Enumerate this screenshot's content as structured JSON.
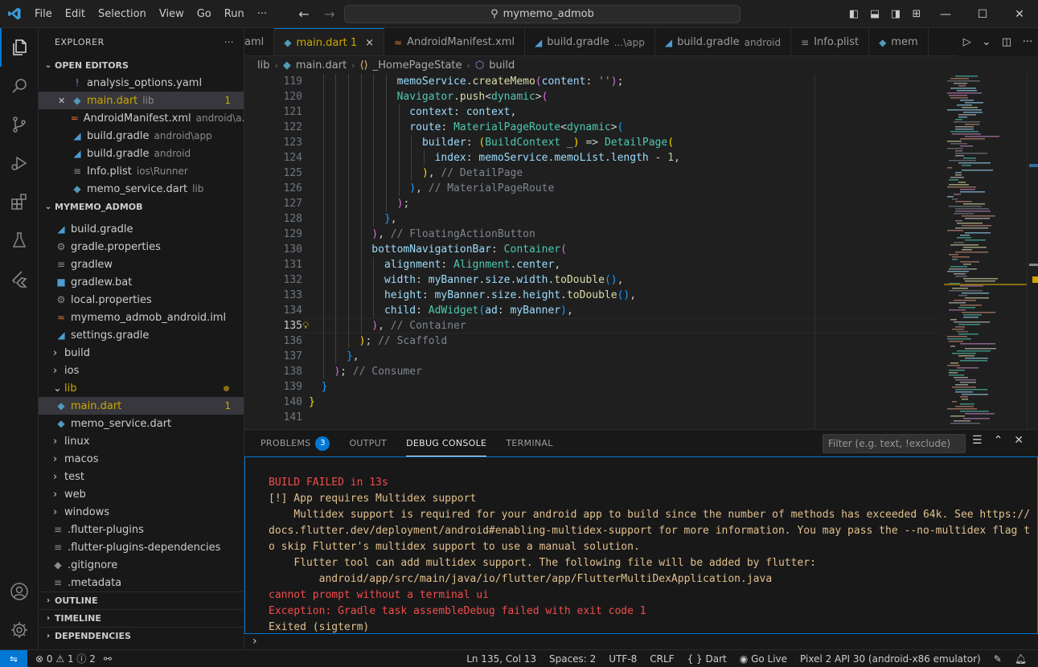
{
  "titlebar": {
    "menus": [
      "File",
      "Edit",
      "Selection",
      "View",
      "Go",
      "Run",
      "···"
    ],
    "search": "mymemo_admob"
  },
  "explorer": {
    "title": "EXPLORER",
    "more": "···",
    "open_editors_title": "OPEN EDITORS",
    "open_editors": [
      {
        "name": "analysis_options.yaml",
        "desc": "",
        "icon": "!",
        "icon_class": "c-yaml"
      },
      {
        "name": "main.dart",
        "desc": "lib",
        "badge": "1",
        "icon": "◆",
        "icon_class": "c-dart",
        "warn": true
      },
      {
        "name": "AndroidManifest.xml",
        "desc": "android\\a...",
        "icon": "≈",
        "icon_class": "c-rss"
      },
      {
        "name": "build.gradle",
        "desc": "android\\app",
        "icon": "◢",
        "icon_class": "c-gradle"
      },
      {
        "name": "build.gradle",
        "desc": "android",
        "icon": "◢",
        "icon_class": "c-gradle"
      },
      {
        "name": "Info.plist",
        "desc": "ios\\Runner",
        "icon": "≡",
        "icon_class": "c-gray"
      },
      {
        "name": "memo_service.dart",
        "desc": "lib",
        "icon": "◆",
        "icon_class": "c-dart"
      }
    ],
    "project_title": "MYMEMO_ADMOB",
    "tree": [
      {
        "name": "build.gradle",
        "indent": 1,
        "icon": "◢",
        "icon_class": "c-gradle"
      },
      {
        "name": "gradle.properties",
        "indent": 1,
        "icon": "⚙",
        "icon_class": "c-gray"
      },
      {
        "name": "gradlew",
        "indent": 1,
        "icon": "≡",
        "icon_class": "c-gray"
      },
      {
        "name": "gradlew.bat",
        "indent": 1,
        "icon": "■",
        "icon_class": "c-gradle"
      },
      {
        "name": "local.properties",
        "indent": 1,
        "icon": "⚙",
        "icon_class": "c-gray"
      },
      {
        "name": "mymemo_admob_android.iml",
        "indent": 1,
        "icon": "≈",
        "icon_class": "c-rss"
      },
      {
        "name": "settings.gradle",
        "indent": 1,
        "icon": "◢",
        "icon_class": "c-gradle"
      },
      {
        "name": "build",
        "indent": 0,
        "chev": "›",
        "folder": true
      },
      {
        "name": "ios",
        "indent": 0,
        "chev": "›",
        "folder": true
      },
      {
        "name": "lib",
        "indent": 0,
        "chev": "⌄",
        "folder": true,
        "warn": true,
        "dot": true
      },
      {
        "name": "main.dart",
        "indent": 1,
        "icon": "◆",
        "icon_class": "c-dart",
        "warn": true,
        "badge": "1",
        "selected": true
      },
      {
        "name": "memo_service.dart",
        "indent": 1,
        "icon": "◆",
        "icon_class": "c-dart"
      },
      {
        "name": "linux",
        "indent": 0,
        "chev": "›",
        "folder": true
      },
      {
        "name": "macos",
        "indent": 0,
        "chev": "›",
        "folder": true
      },
      {
        "name": "test",
        "indent": 0,
        "chev": "›",
        "folder": true
      },
      {
        "name": "web",
        "indent": 0,
        "chev": "›",
        "folder": true
      },
      {
        "name": "windows",
        "indent": 0,
        "chev": "›",
        "folder": true
      },
      {
        "name": ".flutter-plugins",
        "indent": 0,
        "icon": "≡",
        "icon_class": "c-gray"
      },
      {
        "name": ".flutter-plugins-dependencies",
        "indent": 0,
        "icon": "≡",
        "icon_class": "c-gray"
      },
      {
        "name": ".gitignore",
        "indent": 0,
        "icon": "◆",
        "icon_class": "c-git"
      },
      {
        "name": ".metadata",
        "indent": 0,
        "icon": "≡",
        "icon_class": "c-gray"
      }
    ],
    "outline": "OUTLINE",
    "timeline": "TIMELINE",
    "dependencies": "DEPENDENCIES"
  },
  "tabs": [
    {
      "label": "aml",
      "desc": "",
      "icon": ""
    },
    {
      "label": "main.dart 1",
      "desc": "",
      "icon": "◆",
      "active": true,
      "close": "×",
      "warn": true
    },
    {
      "label": "AndroidManifest.xml",
      "desc": "",
      "icon": "≈"
    },
    {
      "label": "build.gradle",
      "desc": "...\\app",
      "icon": "◢"
    },
    {
      "label": "build.gradle",
      "desc": "android",
      "icon": "◢"
    },
    {
      "label": "Info.plist",
      "desc": "",
      "icon": "≡"
    },
    {
      "label": "mem",
      "desc": "",
      "icon": "◆"
    }
  ],
  "breadcrumb": [
    "lib",
    "main.dart",
    "_HomePageState",
    "build"
  ],
  "editor": {
    "current_line": 135,
    "lines": [
      {
        "n": 119,
        "html": [
          [
            "k-id",
            "memoService"
          ],
          [
            "",
            "."
          ],
          [
            "k-fn",
            "createMemo"
          ],
          [
            "k-p2",
            "("
          ],
          [
            "k-id",
            "content"
          ],
          [
            "",
            ": "
          ],
          [
            "k-str",
            "''"
          ],
          [
            "k-p2",
            ")"
          ],
          [
            "",
            ";"
          ]
        ],
        "indent": 14
      },
      {
        "n": 120,
        "html": [
          [
            "k-cls",
            "Navigator"
          ],
          [
            "",
            "."
          ],
          [
            "k-fn",
            "push"
          ],
          [
            "",
            "<"
          ],
          [
            "k-cls",
            "dynamic"
          ],
          [
            "",
            ">"
          ],
          [
            "k-p2",
            "("
          ]
        ],
        "indent": 14
      },
      {
        "n": 121,
        "html": [
          [
            "k-id",
            "context"
          ],
          [
            "",
            ": "
          ],
          [
            "k-id",
            "context"
          ],
          [
            "",
            ","
          ]
        ],
        "indent": 16
      },
      {
        "n": 122,
        "html": [
          [
            "k-id",
            "route"
          ],
          [
            "",
            ": "
          ],
          [
            "k-cls",
            "MaterialPageRoute"
          ],
          [
            "",
            "<"
          ],
          [
            "k-cls",
            "dynamic"
          ],
          [
            "",
            ">"
          ],
          [
            "k-p3",
            "("
          ]
        ],
        "indent": 16
      },
      {
        "n": 123,
        "html": [
          [
            "k-id",
            "builder"
          ],
          [
            "",
            ": "
          ],
          [
            "k-p1",
            "("
          ],
          [
            "k-cls",
            "BuildContext"
          ],
          [
            "",
            " _"
          ],
          [
            "k-p1",
            ")"
          ],
          [
            "",
            " => "
          ],
          [
            "k-cls",
            "DetailPage"
          ],
          [
            "k-p1",
            "("
          ]
        ],
        "indent": 18
      },
      {
        "n": 124,
        "html": [
          [
            "k-id",
            "index"
          ],
          [
            "",
            ": "
          ],
          [
            "k-id",
            "memoService"
          ],
          [
            "",
            "."
          ],
          [
            "k-id",
            "memoList"
          ],
          [
            "",
            "."
          ],
          [
            "k-id",
            "length"
          ],
          [
            "",
            " - "
          ],
          [
            "k-num",
            "1"
          ],
          [
            "",
            ","
          ]
        ],
        "indent": 20
      },
      {
        "n": 125,
        "html": [
          [
            "k-p1",
            ")"
          ],
          [
            "",
            ", "
          ],
          [
            "k-cm",
            "// DetailPage"
          ]
        ],
        "indent": 18
      },
      {
        "n": 126,
        "html": [
          [
            "k-p3",
            ")"
          ],
          [
            "",
            ", "
          ],
          [
            "k-cm",
            "// MaterialPageRoute"
          ]
        ],
        "indent": 16
      },
      {
        "n": 127,
        "html": [
          [
            "k-p2",
            ")"
          ],
          [
            "",
            ";"
          ]
        ],
        "indent": 14
      },
      {
        "n": 128,
        "html": [
          [
            "k-p3",
            "}"
          ],
          [
            "",
            ","
          ]
        ],
        "indent": 12
      },
      {
        "n": 129,
        "html": [
          [
            "k-p2",
            ")"
          ],
          [
            "",
            ", "
          ],
          [
            "k-cm",
            "// FloatingActionButton"
          ]
        ],
        "indent": 10
      },
      {
        "n": 130,
        "html": [
          [
            "k-id",
            "bottomNavigationBar"
          ],
          [
            "",
            ": "
          ],
          [
            "k-cls",
            "Container"
          ],
          [
            "k-p2",
            "("
          ]
        ],
        "indent": 10
      },
      {
        "n": 131,
        "html": [
          [
            "k-id",
            "alignment"
          ],
          [
            "",
            ": "
          ],
          [
            "k-cls",
            "Alignment"
          ],
          [
            "",
            "."
          ],
          [
            "k-id",
            "center"
          ],
          [
            "",
            ","
          ]
        ],
        "indent": 12
      },
      {
        "n": 132,
        "html": [
          [
            "k-id",
            "width"
          ],
          [
            "",
            ": "
          ],
          [
            "k-id",
            "myBanner"
          ],
          [
            "",
            "."
          ],
          [
            "k-id",
            "size"
          ],
          [
            "",
            "."
          ],
          [
            "k-id",
            "width"
          ],
          [
            "",
            "."
          ],
          [
            "k-fn",
            "toDouble"
          ],
          [
            "k-p3",
            "()"
          ],
          [
            "",
            ","
          ]
        ],
        "indent": 12
      },
      {
        "n": 133,
        "html": [
          [
            "k-id",
            "height"
          ],
          [
            "",
            ": "
          ],
          [
            "k-id",
            "myBanner"
          ],
          [
            "",
            "."
          ],
          [
            "k-id",
            "size"
          ],
          [
            "",
            "."
          ],
          [
            "k-id",
            "height"
          ],
          [
            "",
            "."
          ],
          [
            "k-fn",
            "toDouble"
          ],
          [
            "k-p3",
            "()"
          ],
          [
            "",
            ","
          ]
        ],
        "indent": 12
      },
      {
        "n": 134,
        "html": [
          [
            "k-id",
            "child"
          ],
          [
            "",
            ": "
          ],
          [
            "k-cls",
            "AdWidget"
          ],
          [
            "k-p3",
            "("
          ],
          [
            "k-id",
            "ad"
          ],
          [
            "",
            ": "
          ],
          [
            "k-id",
            "myBanner"
          ],
          [
            "k-p3",
            ")"
          ],
          [
            "",
            ","
          ]
        ],
        "indent": 12
      },
      {
        "n": 135,
        "html": [
          [
            "k-p2",
            ")"
          ],
          [
            "",
            ", "
          ],
          [
            "k-cm",
            "// Container"
          ]
        ],
        "indent": 10
      },
      {
        "n": 136,
        "html": [
          [
            "k-p1",
            ")"
          ],
          [
            "",
            "; "
          ],
          [
            "k-cm",
            "// Scaffold"
          ]
        ],
        "indent": 8
      },
      {
        "n": 137,
        "html": [
          [
            "k-p3",
            "}"
          ],
          [
            "",
            ","
          ]
        ],
        "indent": 6
      },
      {
        "n": 138,
        "html": [
          [
            "k-p2",
            ")"
          ],
          [
            "",
            "; "
          ],
          [
            "k-cm",
            "// Consumer"
          ]
        ],
        "indent": 4
      },
      {
        "n": 139,
        "html": [
          [
            "k-p3",
            "}"
          ]
        ],
        "indent": 2
      },
      {
        "n": 140,
        "html": [
          [
            "k-p1",
            "}"
          ]
        ],
        "indent": 0
      },
      {
        "n": 141,
        "html": [],
        "indent": 0
      }
    ],
    "top_partial_line": 118
  },
  "panel": {
    "tabs": [
      {
        "label": "PROBLEMS",
        "badge": "3"
      },
      {
        "label": "OUTPUT"
      },
      {
        "label": "DEBUG CONSOLE",
        "active": true
      },
      {
        "label": "TERMINAL"
      }
    ],
    "filter_placeholder": "Filter (e.g. text, !exclude)",
    "console": [
      {
        "cls": "cl-red",
        "text": "BUILD FAILED in 13s"
      },
      {
        "cls": "cl-yellow",
        "text": "[!] App requires Multidex support"
      },
      {
        "cls": "cl-yellow",
        "text": "    Multidex support is required for your android app to build since the number of methods has exceeded 64k. See https://docs.flutter.dev/deployment/android#enabling-multidex-support for more information. You may pass the --no-multidex flag to skip Flutter's multidex support to use a manual solution."
      },
      {
        "cls": "cl-yellow",
        "text": "    Flutter tool can add multidex support. The following file will be added by flutter:"
      },
      {
        "cls": "cl-yellow",
        "text": "        android/app/src/main/java/io/flutter/app/FlutterMultiDexApplication.java"
      },
      {
        "cls": "cl-red",
        "text": "cannot prompt without a terminal ui"
      },
      {
        "cls": "cl-red",
        "text": "Exception: Gradle task assembleDebug failed with exit code 1"
      },
      {
        "cls": "cl-yellow",
        "text": "Exited (sigterm)"
      }
    ],
    "prompt": "›"
  },
  "status": {
    "errors": "0",
    "warnings": "1",
    "infos": "2",
    "position": "Ln 135, Col 13",
    "spaces": "Spaces: 2",
    "encoding": "UTF-8",
    "eol": "CRLF",
    "language": "Dart",
    "golive": "Go Live",
    "device": "Pixel 2 API 30 (android-x86 emulator)"
  },
  "colors": {
    "accent": "#0078d4",
    "warning": "#cca700",
    "error": "#f14c4c"
  }
}
